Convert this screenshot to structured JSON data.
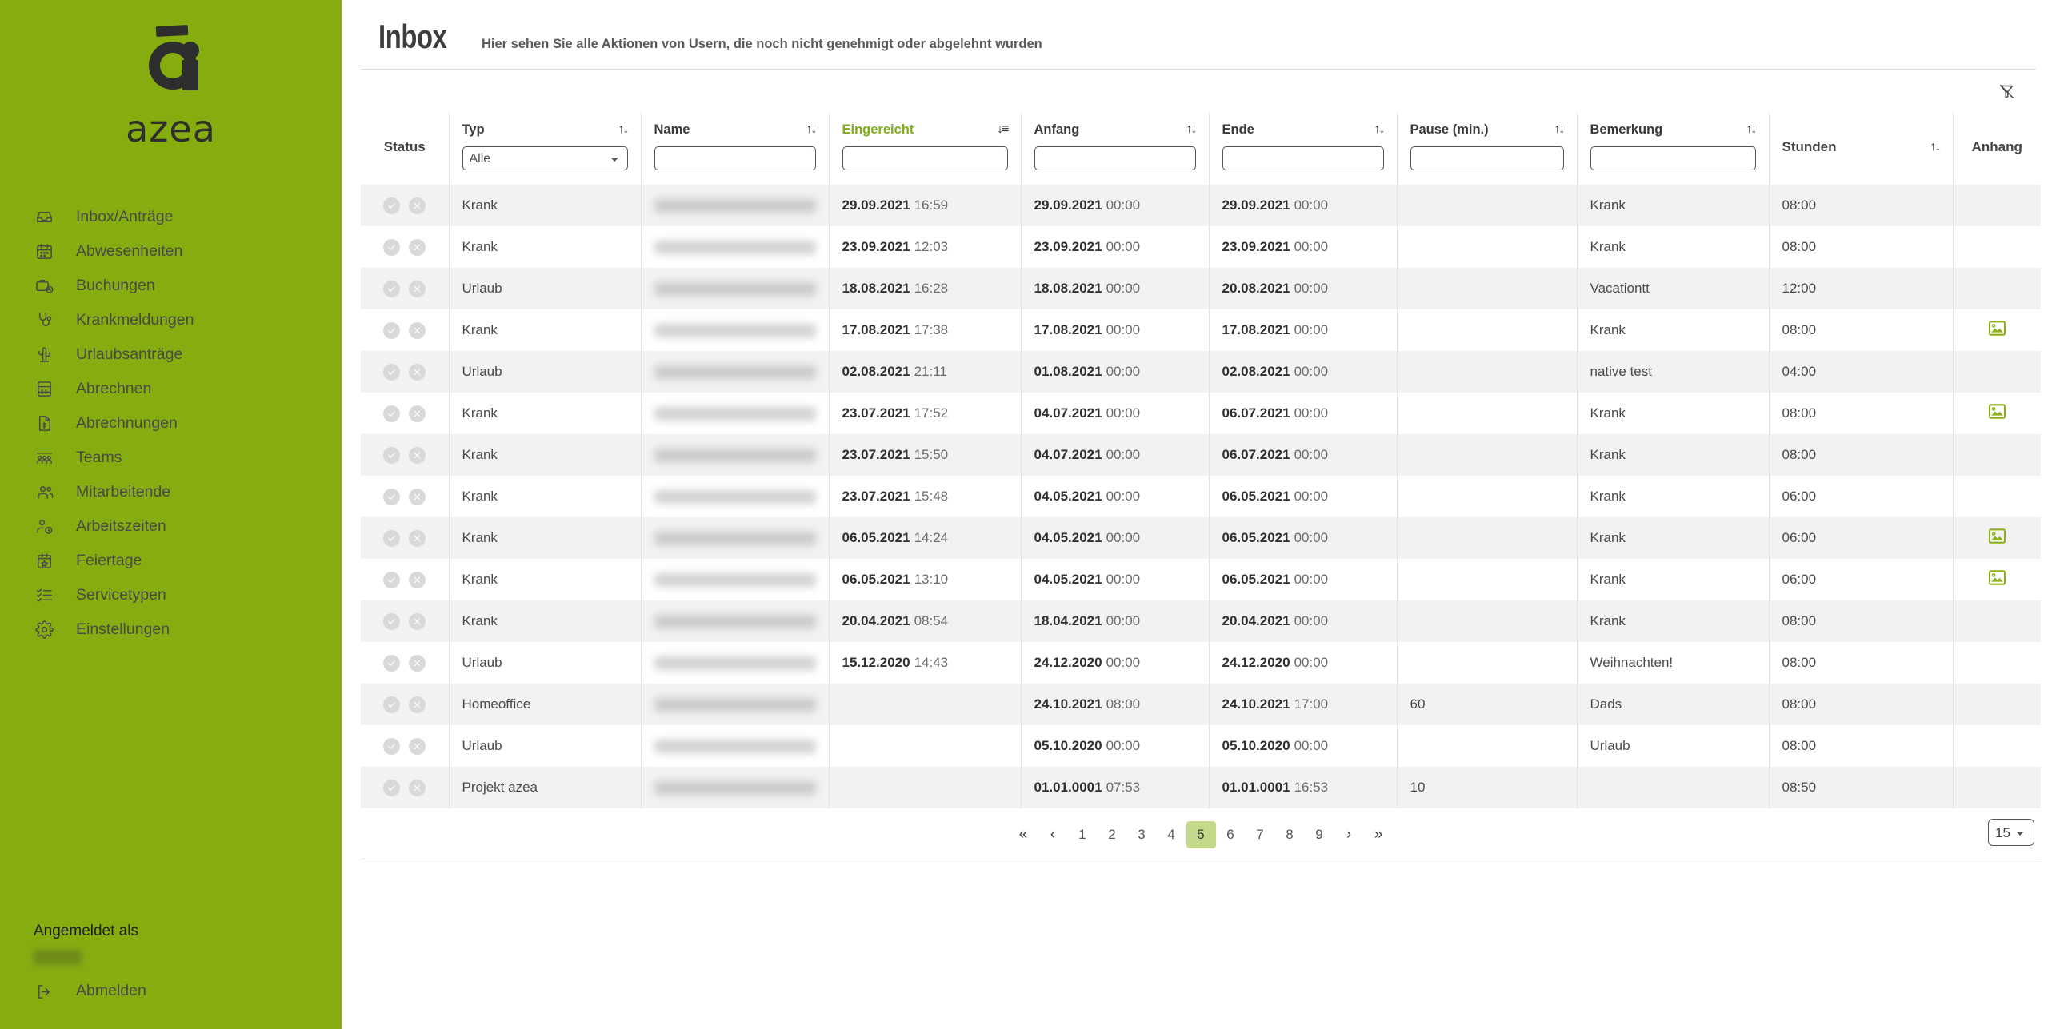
{
  "brand": {
    "name": "azea",
    "sidebar_color": "#85ad10",
    "accent_green": "#7fae1b",
    "pager_active_bg": "#c5d98a"
  },
  "sidebar": {
    "items": [
      {
        "label": "Inbox/Anträge",
        "icon": "inbox-icon"
      },
      {
        "label": "Abwesenheiten",
        "icon": "calendar-icon"
      },
      {
        "label": "Buchungen",
        "icon": "briefcase-clock-icon"
      },
      {
        "label": "Krankmeldungen",
        "icon": "stethoscope-icon"
      },
      {
        "label": "Urlaubsanträge",
        "icon": "cactus-icon"
      },
      {
        "label": "Abrechnen",
        "icon": "calculator-icon"
      },
      {
        "label": "Abrechnungen",
        "icon": "invoice-icon"
      },
      {
        "label": "Teams",
        "icon": "teams-icon"
      },
      {
        "label": "Mitarbeitende",
        "icon": "users-icon"
      },
      {
        "label": "Arbeitszeiten",
        "icon": "user-clock-icon"
      },
      {
        "label": "Feiertage",
        "icon": "calendar-star-icon"
      },
      {
        "label": "Servicetypen",
        "icon": "checklist-icon"
      },
      {
        "label": "Einstellungen",
        "icon": "gear-icon"
      }
    ],
    "footer": {
      "logged_in_label": "Angemeldet als",
      "logout_label": "Abmelden"
    }
  },
  "header": {
    "title": "Inbox",
    "subtitle": "Hier sehen Sie alle Aktionen von Usern, die noch nicht genehmigt oder abgelehnt wurden"
  },
  "toolbar": {
    "clear_filter_icon": "filter-off-icon"
  },
  "table": {
    "columns": [
      {
        "key": "status",
        "label": "Status",
        "sortable": false,
        "filter": null
      },
      {
        "key": "typ",
        "label": "Typ",
        "sortable": true,
        "filter": "select",
        "value": "Alle"
      },
      {
        "key": "name",
        "label": "Name",
        "sortable": true,
        "filter": "text",
        "value": ""
      },
      {
        "key": "eingereicht",
        "label": "Eingereicht",
        "sortable": true,
        "filter": "text",
        "value": "",
        "active_sort": true,
        "sort_dir": "desc"
      },
      {
        "key": "anfang",
        "label": "Anfang",
        "sortable": true,
        "filter": "text",
        "value": ""
      },
      {
        "key": "ende",
        "label": "Ende",
        "sortable": true,
        "filter": "text",
        "value": ""
      },
      {
        "key": "pause",
        "label": "Pause (min.)",
        "sortable": true,
        "filter": "text",
        "value": ""
      },
      {
        "key": "bemerkung",
        "label": "Bemerkung",
        "sortable": true,
        "filter": "text",
        "value": ""
      },
      {
        "key": "stunden",
        "label": "Stunden",
        "sortable": true,
        "filter": null
      },
      {
        "key": "anhang",
        "label": "Anhang",
        "sortable": false,
        "filter": null
      }
    ],
    "typ_options": [
      "Alle"
    ],
    "rows": [
      {
        "typ": "Krank",
        "name_redacted": true,
        "eingereicht_d": "29.09.2021",
        "eingereicht_t": "16:59",
        "anfang_d": "29.09.2021",
        "anfang_t": "00:00",
        "ende_d": "29.09.2021",
        "ende_t": "00:00",
        "pause": "",
        "bemerkung": "Krank",
        "stunden": "08:00",
        "anhang": false
      },
      {
        "typ": "Krank",
        "name_redacted": true,
        "eingereicht_d": "23.09.2021",
        "eingereicht_t": "12:03",
        "anfang_d": "23.09.2021",
        "anfang_t": "00:00",
        "ende_d": "23.09.2021",
        "ende_t": "00:00",
        "pause": "",
        "bemerkung": "Krank",
        "stunden": "08:00",
        "anhang": false
      },
      {
        "typ": "Urlaub",
        "name_redacted": true,
        "eingereicht_d": "18.08.2021",
        "eingereicht_t": "16:28",
        "anfang_d": "18.08.2021",
        "anfang_t": "00:00",
        "ende_d": "20.08.2021",
        "ende_t": "00:00",
        "pause": "",
        "bemerkung": "Vacationtt",
        "stunden": "12:00",
        "anhang": false
      },
      {
        "typ": "Krank",
        "name_redacted": true,
        "eingereicht_d": "17.08.2021",
        "eingereicht_t": "17:38",
        "anfang_d": "17.08.2021",
        "anfang_t": "00:00",
        "ende_d": "17.08.2021",
        "ende_t": "00:00",
        "pause": "",
        "bemerkung": "Krank",
        "stunden": "08:00",
        "anhang": true
      },
      {
        "typ": "Urlaub",
        "name_redacted": true,
        "eingereicht_d": "02.08.2021",
        "eingereicht_t": "21:11",
        "anfang_d": "01.08.2021",
        "anfang_t": "00:00",
        "ende_d": "02.08.2021",
        "ende_t": "00:00",
        "pause": "",
        "bemerkung": "native test",
        "stunden": "04:00",
        "anhang": false
      },
      {
        "typ": "Krank",
        "name_redacted": true,
        "eingereicht_d": "23.07.2021",
        "eingereicht_t": "17:52",
        "anfang_d": "04.07.2021",
        "anfang_t": "00:00",
        "ende_d": "06.07.2021",
        "ende_t": "00:00",
        "pause": "",
        "bemerkung": "Krank",
        "stunden": "08:00",
        "anhang": true
      },
      {
        "typ": "Krank",
        "name_redacted": true,
        "eingereicht_d": "23.07.2021",
        "eingereicht_t": "15:50",
        "anfang_d": "04.07.2021",
        "anfang_t": "00:00",
        "ende_d": "06.07.2021",
        "ende_t": "00:00",
        "pause": "",
        "bemerkung": "Krank",
        "stunden": "08:00",
        "anhang": false
      },
      {
        "typ": "Krank",
        "name_redacted": true,
        "eingereicht_d": "23.07.2021",
        "eingereicht_t": "15:48",
        "anfang_d": "04.05.2021",
        "anfang_t": "00:00",
        "ende_d": "06.05.2021",
        "ende_t": "00:00",
        "pause": "",
        "bemerkung": "Krank",
        "stunden": "06:00",
        "anhang": false
      },
      {
        "typ": "Krank",
        "name_redacted": true,
        "eingereicht_d": "06.05.2021",
        "eingereicht_t": "14:24",
        "anfang_d": "04.05.2021",
        "anfang_t": "00:00",
        "ende_d": "06.05.2021",
        "ende_t": "00:00",
        "pause": "",
        "bemerkung": "Krank",
        "stunden": "06:00",
        "anhang": true
      },
      {
        "typ": "Krank",
        "name_redacted": true,
        "eingereicht_d": "06.05.2021",
        "eingereicht_t": "13:10",
        "anfang_d": "04.05.2021",
        "anfang_t": "00:00",
        "ende_d": "06.05.2021",
        "ende_t": "00:00",
        "pause": "",
        "bemerkung": "Krank",
        "stunden": "06:00",
        "anhang": true
      },
      {
        "typ": "Krank",
        "name_redacted": true,
        "eingereicht_d": "20.04.2021",
        "eingereicht_t": "08:54",
        "anfang_d": "18.04.2021",
        "anfang_t": "00:00",
        "ende_d": "20.04.2021",
        "ende_t": "00:00",
        "pause": "",
        "bemerkung": "Krank",
        "stunden": "08:00",
        "anhang": false
      },
      {
        "typ": "Urlaub",
        "name_redacted": true,
        "eingereicht_d": "15.12.2020",
        "eingereicht_t": "14:43",
        "anfang_d": "24.12.2020",
        "anfang_t": "00:00",
        "ende_d": "24.12.2020",
        "ende_t": "00:00",
        "pause": "",
        "bemerkung": "Weihnachten!",
        "stunden": "08:00",
        "anhang": false
      },
      {
        "typ": "Homeoffice",
        "name_redacted": true,
        "eingereicht_d": "",
        "eingereicht_t": "",
        "anfang_d": "24.10.2021",
        "anfang_t": "08:00",
        "ende_d": "24.10.2021",
        "ende_t": "17:00",
        "pause": "60",
        "bemerkung": "Dads",
        "stunden": "08:00",
        "anhang": false
      },
      {
        "typ": "Urlaub",
        "name_redacted": true,
        "eingereicht_d": "",
        "eingereicht_t": "",
        "anfang_d": "05.10.2020",
        "anfang_t": "00:00",
        "ende_d": "05.10.2020",
        "ende_t": "00:00",
        "pause": "",
        "bemerkung": "Urlaub",
        "stunden": "08:00",
        "anhang": false
      },
      {
        "typ": "Projekt azea",
        "name_redacted": true,
        "eingereicht_d": "",
        "eingereicht_t": "",
        "anfang_d": "01.01.0001",
        "anfang_t": "07:53",
        "ende_d": "01.01.0001",
        "ende_t": "16:53",
        "pause": "10",
        "bemerkung": "",
        "stunden": "08:50",
        "anhang": false
      }
    ]
  },
  "pagination": {
    "first_label": "«",
    "prev_label": "‹",
    "next_label": "›",
    "last_label": "»",
    "pages": [
      "1",
      "2",
      "3",
      "4",
      "5",
      "6",
      "7",
      "8",
      "9"
    ],
    "current": "5",
    "page_size": "15",
    "page_size_options": [
      "15"
    ]
  }
}
